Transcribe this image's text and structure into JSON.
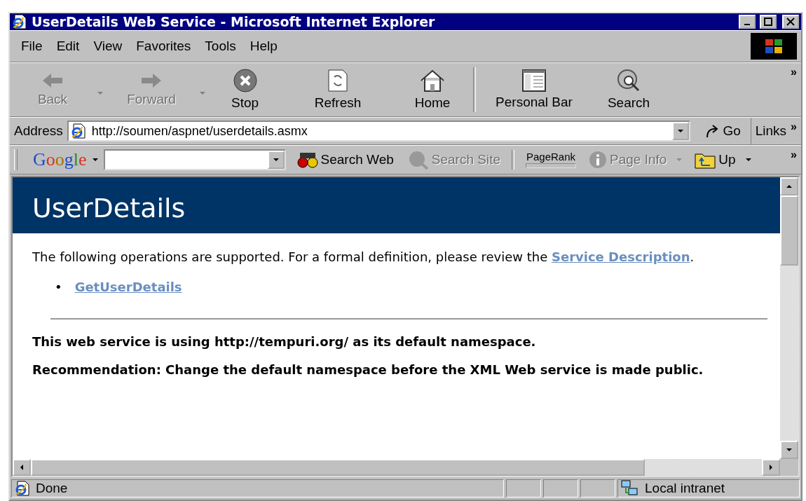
{
  "window": {
    "title": "UserDetails Web Service - Microsoft Internet Explorer"
  },
  "menu": [
    "File",
    "Edit",
    "View",
    "Favorites",
    "Tools",
    "Help"
  ],
  "toolbar": {
    "buttons": [
      {
        "kind": "back",
        "label": "Back",
        "disabled": true,
        "dropdown": true
      },
      {
        "kind": "forward",
        "label": "Forward",
        "disabled": true,
        "dropdown": true
      },
      {
        "kind": "stop",
        "label": "Stop",
        "disabled": false,
        "dropdown": false
      },
      {
        "kind": "refresh",
        "label": "Refresh",
        "disabled": false,
        "dropdown": false
      },
      {
        "kind": "home",
        "label": "Home",
        "disabled": false,
        "dropdown": false
      },
      {
        "kind": "panel",
        "label": "Personal Bar",
        "disabled": false,
        "dropdown": false
      },
      {
        "kind": "search",
        "label": "Search",
        "disabled": false,
        "dropdown": false
      }
    ],
    "overflow": "»"
  },
  "address": {
    "label": "Address",
    "value": "http://soumen/aspnet/userdetails.asmx",
    "go": "Go",
    "links": "Links",
    "overflow": "»"
  },
  "google_bar": {
    "logo": "Google",
    "items": [
      {
        "kind": "button",
        "label": "Search Web",
        "disabled": false
      },
      {
        "kind": "button",
        "label": "Search Site",
        "disabled": true
      },
      {
        "kind": "meter",
        "label": "PageRank",
        "level": 0
      },
      {
        "kind": "menu",
        "label": "Page Info",
        "disabled": true
      },
      {
        "kind": "menu",
        "label": "Up",
        "disabled": false
      }
    ],
    "overflow": "»"
  },
  "page": {
    "heading": "UserDetails",
    "intro": {
      "text": "The following operations are supported. For a formal definition, please review the",
      "link": "Service Description",
      "end": "."
    },
    "operations": [
      {
        "bullet": "•",
        "label": "GetUserDetails"
      }
    ],
    "notes": [
      "This web service is using http://tempuri.org/ as its default namespace.",
      "Recommendation: Change the default namespace before the XML Web service is made public."
    ]
  },
  "status_bar": {
    "text": "Done",
    "zone": "Local intranet"
  }
}
